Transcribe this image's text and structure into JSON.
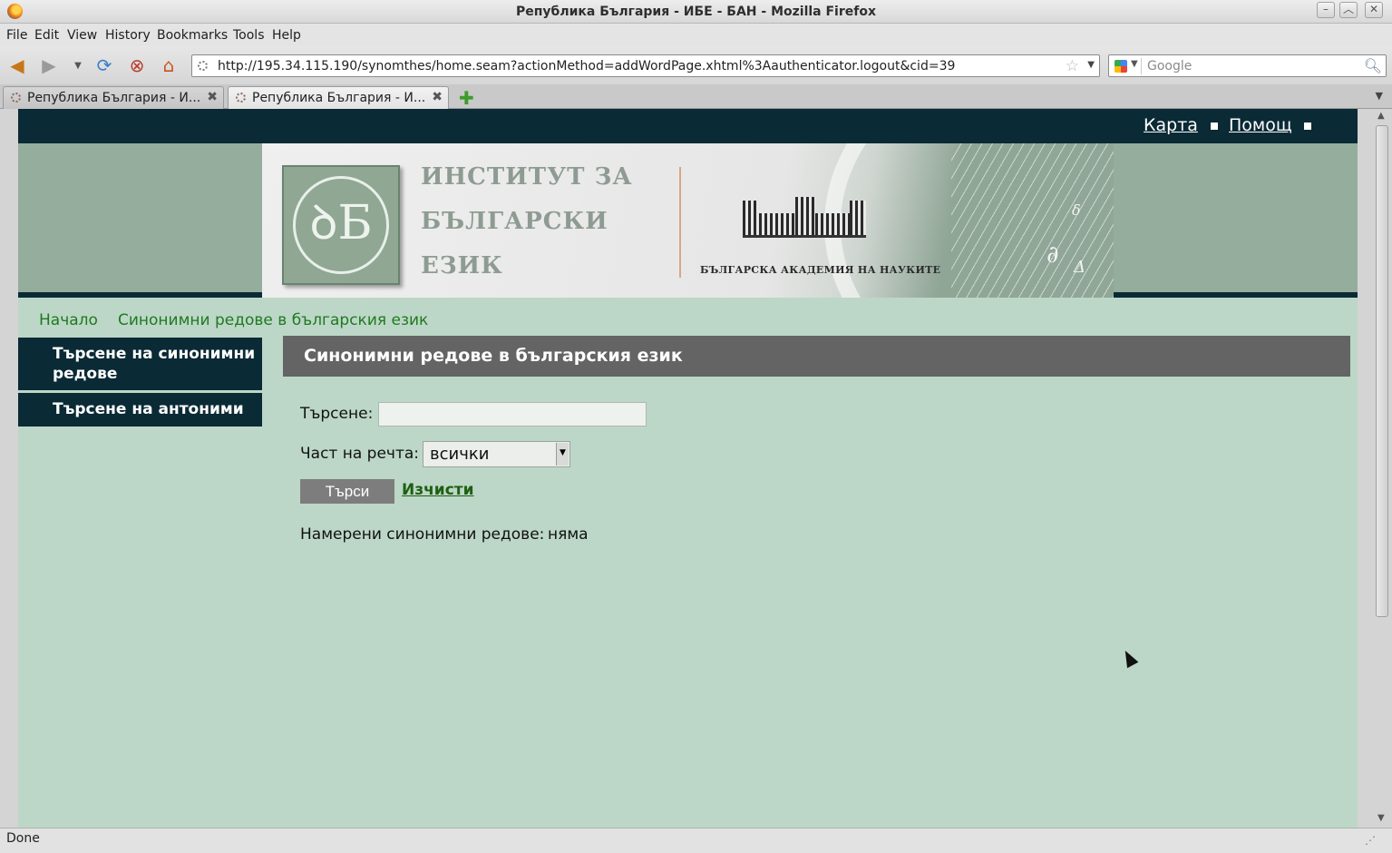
{
  "window": {
    "title": "Република България - ИБЕ - БАН - Mozilla Firefox"
  },
  "menu": [
    "File",
    "Edit",
    "View",
    "History",
    "Bookmarks",
    "Tools",
    "Help"
  ],
  "navbar": {
    "url": "http://195.34.115.190/synomthes/home.seam?actionMethod=addWordPage.xhtml%3Aauthenticator.logout&cid=39",
    "search_placeholder": "Google"
  },
  "tabs": [
    {
      "label": "Република България - И...",
      "active": false
    },
    {
      "label": "Република България - И...",
      "active": true
    }
  ],
  "page": {
    "toplinks": [
      "Карта",
      "Помощ"
    ],
    "banner": {
      "title_lines": [
        "ИНСТИТУТ ЗА",
        "БЪЛГАРСКИ",
        "ЕЗИК"
      ],
      "academy": "БЪЛГАРСКА АКАДЕМИЯ НА НАУКИТЕ"
    },
    "breadcrumb": [
      "Начало",
      "Синонимни редове в българския език"
    ],
    "sidebar": [
      {
        "label": "Търсене на синонимни редове"
      },
      {
        "label": "Търсене на антоними"
      }
    ],
    "main": {
      "heading": "Синонимни редове в българския език",
      "search_label": "Търсене:",
      "search_value": "",
      "pos_label": "Част на речта:",
      "pos_selected": "всички",
      "submit_label": "Търси",
      "clear_label": "Изчисти",
      "results_label": "Намерени синонимни редове:",
      "results_value": "няма"
    }
  },
  "status": {
    "text": "Done"
  }
}
